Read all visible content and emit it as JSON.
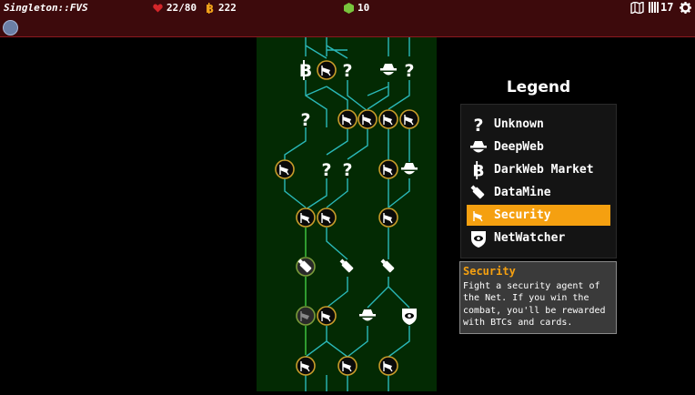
{
  "topbar": {
    "title": "Singleton::FVS",
    "hp": "22/80",
    "btc": "222",
    "cards": "10",
    "deck": "17",
    "colors": {
      "bg": "#3d0a0c",
      "hp": "#d4262a",
      "btc": "#f0a21a",
      "cards": "#78c43c"
    }
  },
  "legend": {
    "title": "Legend",
    "items": [
      {
        "label": "Unknown",
        "icon": "question-icon"
      },
      {
        "label": "DeepWeb",
        "icon": "hat-icon"
      },
      {
        "label": "DarkWeb Market",
        "icon": "bitcoin-icon"
      },
      {
        "label": "DataMine",
        "icon": "usb-icon"
      },
      {
        "label": "Security",
        "icon": "camera-icon",
        "selected": true
      },
      {
        "label": "NetWatcher",
        "icon": "eye-shield-icon"
      }
    ]
  },
  "tooltip": {
    "title": "Security",
    "body": "Fight a security agent of the Net. If you win the combat, you'll be rewarded with BTCs and cards."
  }
}
